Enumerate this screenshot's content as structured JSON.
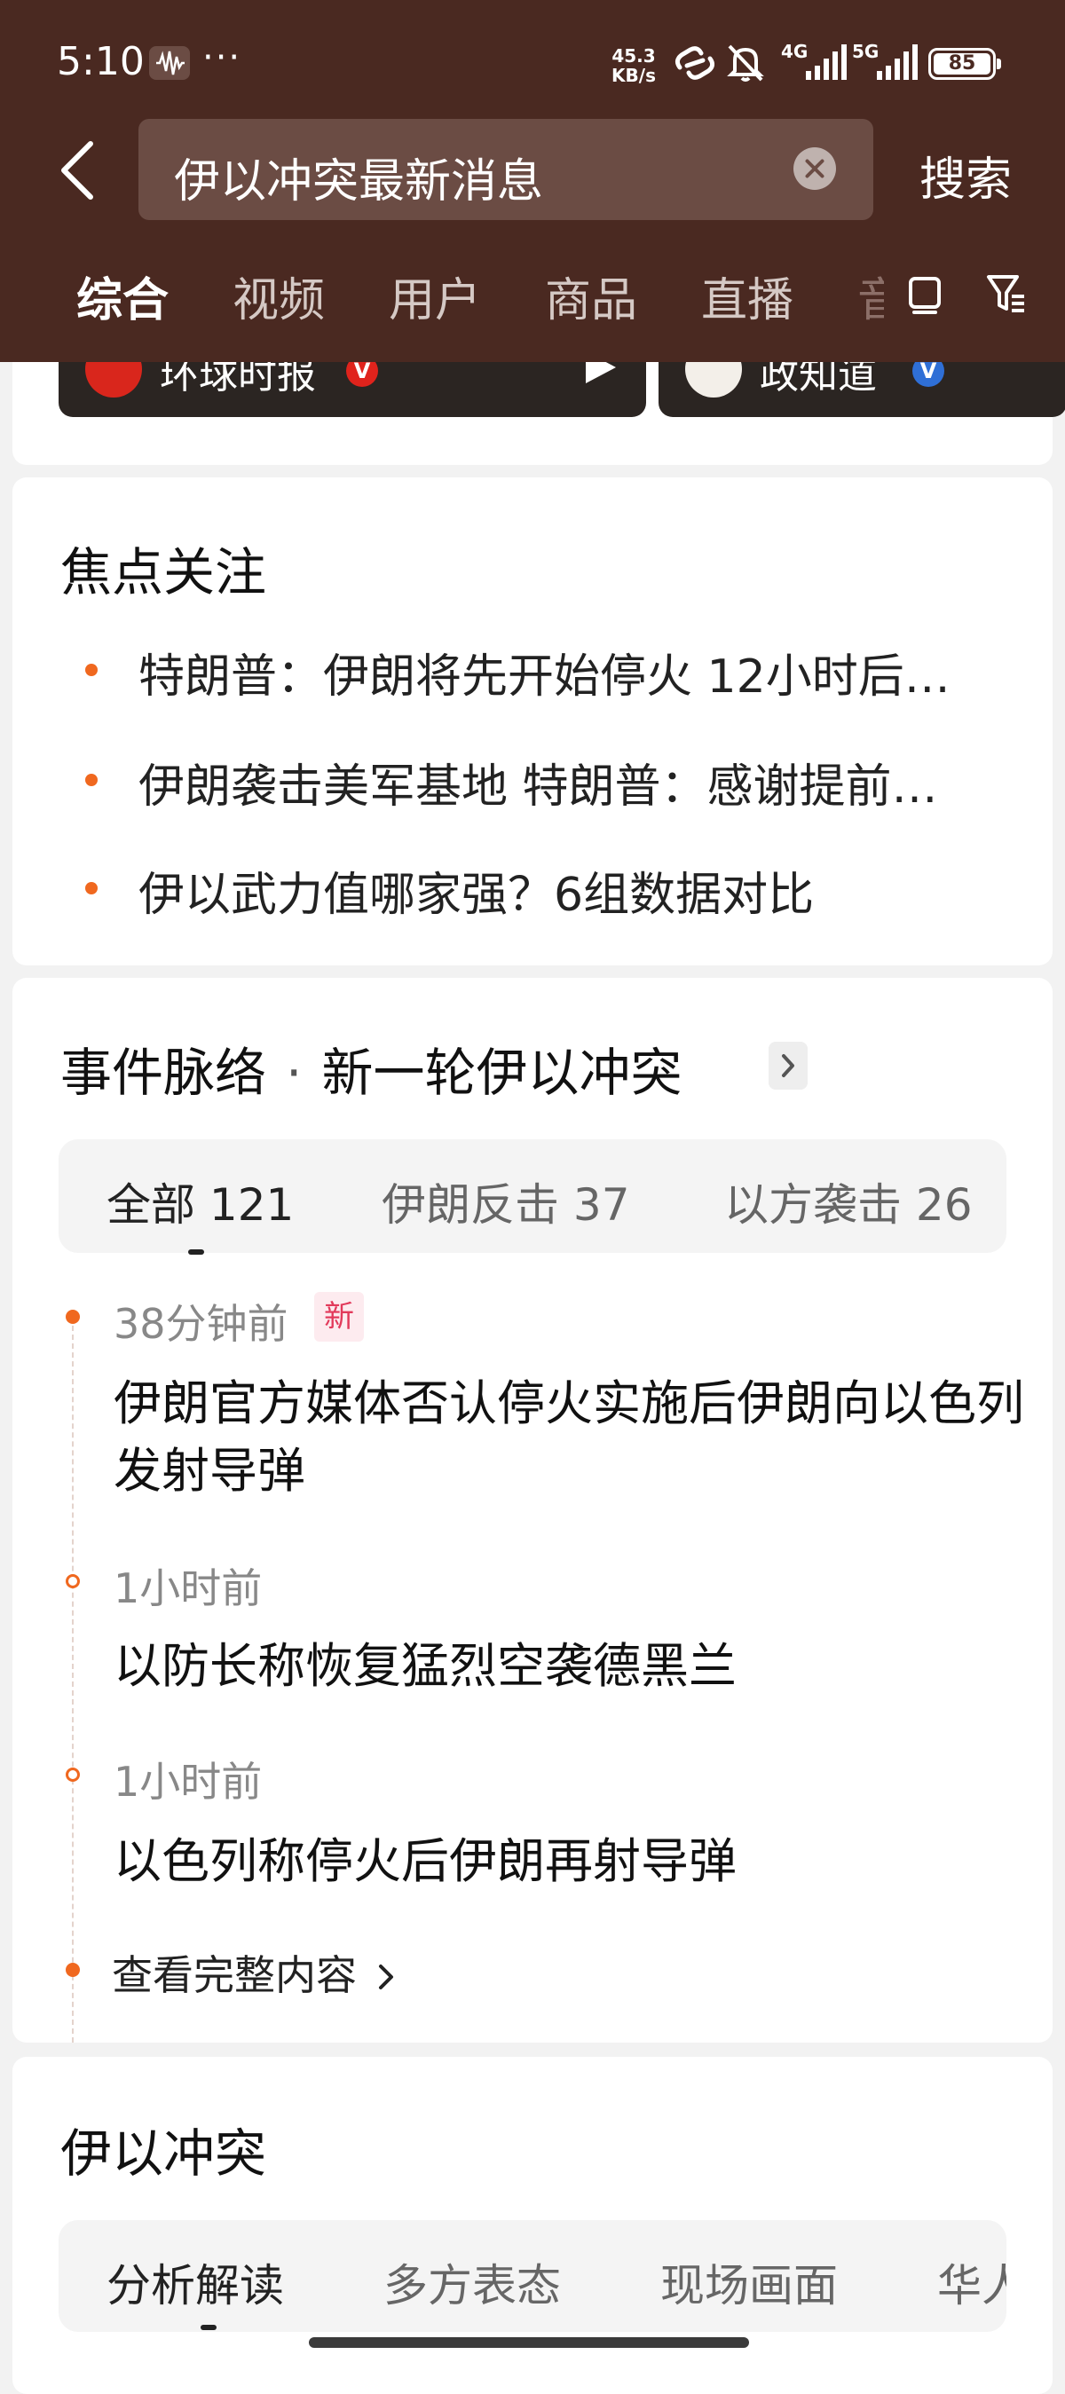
{
  "status_bar": {
    "time": "5:10",
    "more": "···",
    "net_speed_value": "45.3",
    "net_speed_unit": "KB/s",
    "signal1_label": "4G",
    "signal2_label": "5G",
    "battery": "85"
  },
  "search": {
    "query": "伊以冲突最新消息",
    "button": "搜索"
  },
  "tabs": [
    {
      "label": "综合",
      "active": true
    },
    {
      "label": "视频"
    },
    {
      "label": "用户"
    },
    {
      "label": "商品"
    },
    {
      "label": "直播"
    },
    {
      "label": "音"
    }
  ],
  "video_cards": [
    {
      "source": "环球时报"
    },
    {
      "source": "政知道"
    }
  ],
  "focus": {
    "title": "焦点关注",
    "items": [
      "特朗普：伊朗将先开始停火 12小时后…",
      "伊朗袭击美军基地 特朗普：感谢提前…",
      "伊以武力值哪家强？6组数据对比"
    ]
  },
  "events": {
    "title_prefix": "事件脉络",
    "separator": "·",
    "title_topic": "新一轮伊以冲突",
    "segments": [
      {
        "label": "全部 121",
        "active": true
      },
      {
        "label": "伊朗反击 37"
      },
      {
        "label": "以方袭击 26"
      }
    ],
    "timeline": [
      {
        "time": "38分钟前",
        "badge": "新",
        "text": "伊朗官方媒体否认停火实施后伊朗向以色列发射导弹"
      },
      {
        "time": "1小时前",
        "text": "以防长称恢复猛烈空袭德黑兰"
      },
      {
        "time": "1小时前",
        "text": "以色列称停火后伊朗再射导弹"
      }
    ],
    "see_all": "查看完整内容"
  },
  "conflict": {
    "title": "伊以冲突",
    "segments": [
      {
        "label": "分析解读",
        "active": true
      },
      {
        "label": "多方表态"
      },
      {
        "label": "现场画面"
      },
      {
        "label": "华人"
      }
    ]
  },
  "colors": {
    "header_bg": "#4a2921",
    "accent_orange": "#f0681f",
    "badge_red": "#e23a5b"
  }
}
